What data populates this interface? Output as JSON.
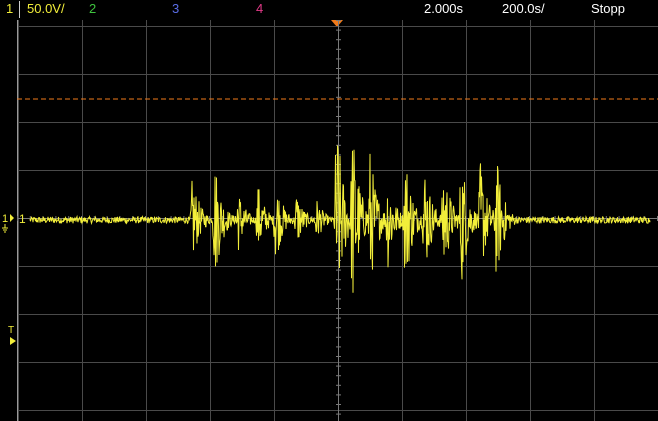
{
  "status": {
    "ch1_number": "1",
    "ch1_scale": "50.0V/",
    "ch2_number": "2",
    "ch3_number": "3",
    "ch4_number": "4",
    "time_position": "2.000s",
    "time_scale": "200.0s/",
    "run_state": "Stopp"
  },
  "markers": {
    "ground_label": "1",
    "channel_label": "1",
    "trigger_source_label": "T"
  },
  "colors": {
    "ch1": "#f2ee3a",
    "ch2": "#3ec33e",
    "ch3": "#5a6de6",
    "ch4": "#e33a88",
    "trigger_level": "#f07a1a",
    "grid": "#4a4a4a",
    "background": "#000000",
    "status_text": "#ffffff"
  },
  "trace": {
    "baseline_level": 0.0,
    "bursts": [
      {
        "t": -4.55,
        "amp": 1.0
      },
      {
        "t": -3.85,
        "amp": 1.35
      },
      {
        "t": -3.15,
        "amp": 0.8
      },
      {
        "t": -2.5,
        "amp": 0.8
      },
      {
        "t": -1.95,
        "amp": 0.95
      },
      {
        "t": -1.3,
        "amp": 0.65
      },
      {
        "t": -0.7,
        "amp": 0.55
      },
      {
        "t": -0.05,
        "amp": 2.3
      },
      {
        "t": 0.45,
        "amp": 2.1
      },
      {
        "t": 1.0,
        "amp": 1.55
      },
      {
        "t": 1.55,
        "amp": 1.1
      },
      {
        "t": 2.1,
        "amp": 1.55
      },
      {
        "t": 2.7,
        "amp": 1.3
      },
      {
        "t": 3.3,
        "amp": 1.3
      },
      {
        "t": 3.85,
        "amp": 1.5
      },
      {
        "t": 4.45,
        "amp": 1.3
      },
      {
        "t": 4.95,
        "amp": 1.4
      }
    ]
  }
}
